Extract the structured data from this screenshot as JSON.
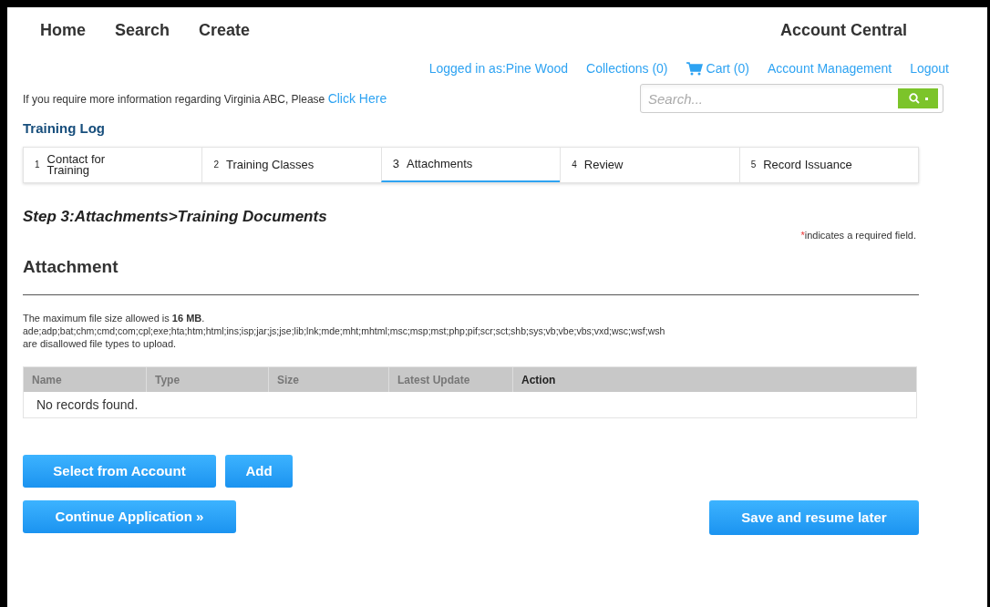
{
  "nav": {
    "items": [
      "Home",
      "Search",
      "Create"
    ],
    "account": "Account Central"
  },
  "user_links": [
    {
      "kind": "text",
      "label": "Logged in as:Pine Wood"
    },
    {
      "kind": "link",
      "label": "Collections (0)"
    },
    {
      "kind": "cart",
      "label": "Cart (0)"
    },
    {
      "kind": "link",
      "label": "Account Management"
    },
    {
      "kind": "link",
      "label": "Logout"
    }
  ],
  "info": {
    "text": "If you require more information regarding Virginia ABC, Please",
    "link": "Click Here"
  },
  "search": {
    "placeholder": "Search..."
  },
  "section_title": "Training Log",
  "steps": [
    {
      "number": "1",
      "label": "Contact for Training",
      "selected": false
    },
    {
      "number": "2",
      "label": "Training Classes",
      "selected": false
    },
    {
      "number": "3",
      "label": "Attachments",
      "selected": true
    },
    {
      "number": "4",
      "label": "Review",
      "selected": false
    },
    {
      "number": "5",
      "label": "Record Issuance",
      "selected": false
    }
  ],
  "step_heading": "Step 3:Attachments>Training Documents",
  "required_note": {
    "mark": "*",
    "text": "indicates a required field."
  },
  "attachment": {
    "title": "Attachment",
    "size_note": "The maximum file size allowed is **16 MB**.",
    "file_types": "ade;adp;bat;chm;cmd;com;cpl;exe;hta;htm;html;ins;isp;jar;js;jse;lib;lnk;mde;mht;mhtml;msc;msp;mst;php;pif;scr;sct;shb;sys;vb;vbe;vbs;vxd;wsc;wsf;wsh",
    "disallowed_note": "are disallowed file types to upload."
  },
  "table": {
    "columns": [
      "Name",
      "Type",
      "Size",
      "Latest Update",
      "Action"
    ],
    "empty": "No records found."
  },
  "buttons": {
    "select": "Select from Account",
    "add": "Add",
    "continue": "Continue Application »",
    "save": "Save and resume later"
  }
}
